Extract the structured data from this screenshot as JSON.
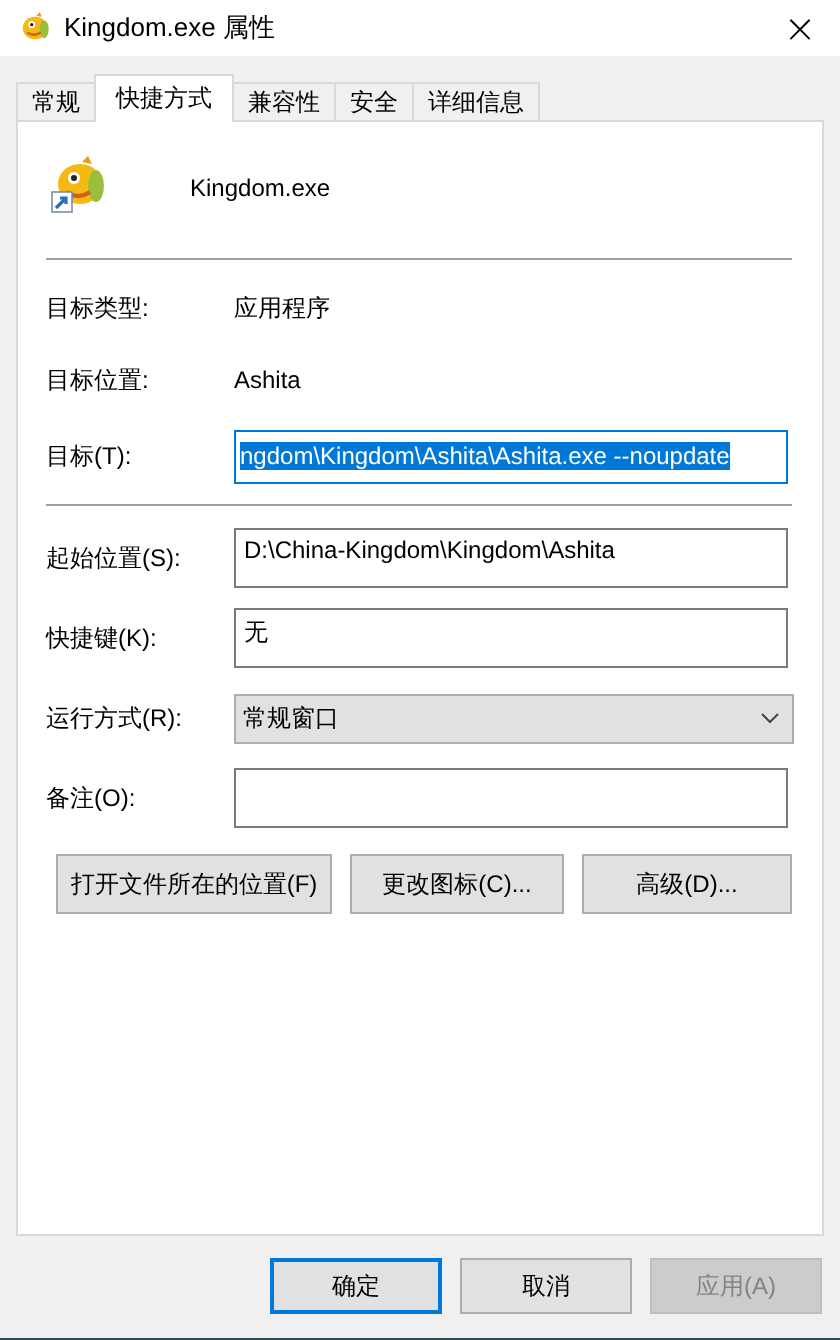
{
  "window": {
    "title": "Kingdom.exe 属性",
    "close": "×"
  },
  "tabs": [
    {
      "label": "常规",
      "selected": false
    },
    {
      "label": "快捷方式",
      "selected": true
    },
    {
      "label": "兼容性",
      "selected": false
    },
    {
      "label": "安全",
      "selected": false
    },
    {
      "label": "详细信息",
      "selected": false
    }
  ],
  "file_name": "Kingdom.exe",
  "info": [
    {
      "label": "目标类型:",
      "value": "应用程序"
    },
    {
      "label": "目标位置:",
      "value": "Ashita"
    }
  ],
  "target": {
    "label": "目标(T):",
    "value": "ngdom\\Kingdom\\Ashita\\Ashita.exe --noupdate",
    "selected": true
  },
  "fields": [
    {
      "kind": "text",
      "label": "起始位置(S):",
      "value": "D:\\China-Kingdom\\Kingdom\\Ashita"
    },
    {
      "kind": "text",
      "label": "快捷键(K):",
      "value": "无"
    },
    {
      "kind": "dropdown",
      "label": "运行方式(R):",
      "value": "常规窗口"
    },
    {
      "kind": "text",
      "label": "备注(O):"
    }
  ],
  "actions": [
    "打开文件所在的位置(F)",
    "更改图标(C)...",
    "高级(D)..."
  ],
  "buttons": [
    {
      "label": "确定",
      "default": true,
      "disabled": false
    },
    {
      "label": "取消",
      "default": false,
      "disabled": false
    },
    {
      "label": "应用(A)",
      "default": false,
      "disabled": true
    }
  ]
}
